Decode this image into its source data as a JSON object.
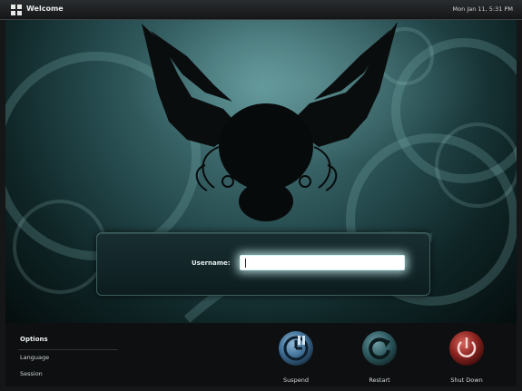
{
  "topbar": {
    "title": "Welcome",
    "clock": "Mon Jan 11,  5:31 PM"
  },
  "login": {
    "username_label": "Username:",
    "username_value": ""
  },
  "options": {
    "header": "Options",
    "items": [
      {
        "label": "Language"
      },
      {
        "label": "Session"
      }
    ]
  },
  "actions": {
    "suspend": {
      "label": "Suspend",
      "icon": "suspend-clock-icon",
      "color": "#3f6f96"
    },
    "restart": {
      "label": "Restart",
      "icon": "restart-arrow-icon",
      "color": "#2f5c62"
    },
    "shutdown": {
      "label": "Shut Down",
      "icon": "power-icon",
      "color": "#8a2420"
    }
  },
  "wallpaper": {
    "icon": "winged-skull-icon"
  }
}
